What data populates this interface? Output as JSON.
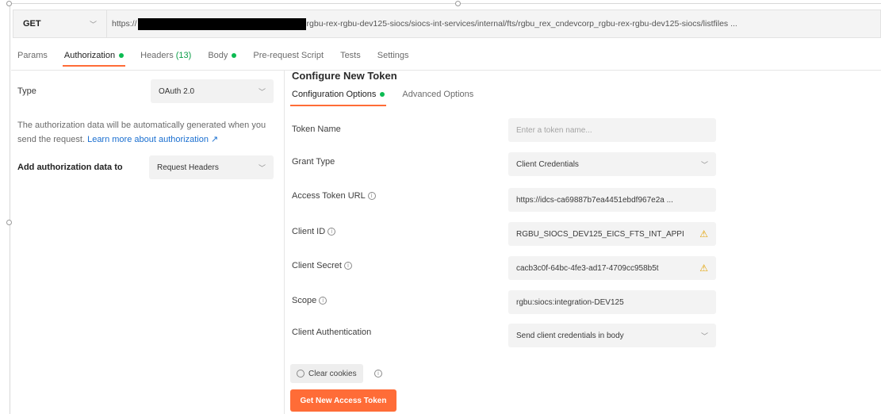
{
  "request": {
    "method": "GET",
    "url_prefix": "https://",
    "url_rest": "rgbu-rex-rgbu-dev125-siocs/siocs-int-services/internal/fts/rgbu_rex_cndevcorp_rgbu-rex-rgbu-dev125-siocs/listfiles ..."
  },
  "tabs": [
    {
      "label": "Params"
    },
    {
      "label": "Authorization"
    },
    {
      "label": "Headers",
      "count": "(13)"
    },
    {
      "label": "Body"
    },
    {
      "label": "Pre-request Script"
    },
    {
      "label": "Tests"
    },
    {
      "label": "Settings"
    }
  ],
  "auth": {
    "type_label": "Type",
    "type_value": "OAuth 2.0",
    "description": "The authorization data will be automatically generated when you send the request.",
    "learn_more": "Learn more about authorization ↗",
    "add_to_label": "Add authorization data to",
    "add_to_value": "Request Headers"
  },
  "config": {
    "title": "Configure New Token",
    "subtabs": [
      {
        "label": "Configuration Options"
      },
      {
        "label": "Advanced Options"
      }
    ],
    "fields": {
      "token_name": {
        "label": "Token Name",
        "placeholder": "Enter a token name..."
      },
      "grant_type": {
        "label": "Grant Type",
        "value": "Client Credentials"
      },
      "access_token_url": {
        "label": "Access Token URL",
        "value": "https://idcs-ca69887b7ea4451ebdf967e2a ..."
      },
      "client_id": {
        "label": "Client ID",
        "value": "RGBU_SIOCS_DEV125_EICS_FTS_INT_APPI"
      },
      "client_secret": {
        "label": "Client Secret",
        "value": "cacb3c0f-64bc-4fe3-ad17-4709cc958b5t"
      },
      "scope": {
        "label": "Scope",
        "value": "rgbu:siocs:integration-DEV125"
      },
      "client_auth": {
        "label": "Client Authentication",
        "value": "Send client credentials in body"
      }
    },
    "clear_cookies": "Clear cookies",
    "get_token": "Get New Access Token"
  },
  "icons": {
    "caret": "chevron-down-icon",
    "info": "info-icon",
    "warning": "warning-icon",
    "dot_color": "#0cbb52",
    "accent": "#ff6c37"
  }
}
